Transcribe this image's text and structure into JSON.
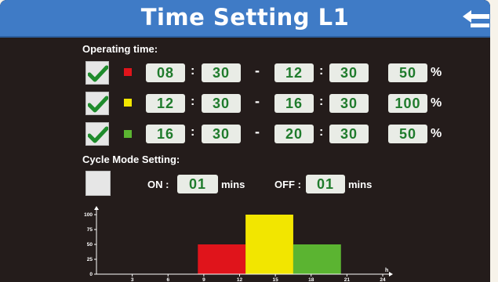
{
  "header": {
    "title": "Time Setting L1",
    "back_icon": "back-arrow-icon"
  },
  "operating": {
    "label": "Operating time:",
    "rows": [
      {
        "checked": true,
        "color": "#e0141b",
        "start_h": "08",
        "start_m": "30",
        "end_h": "12",
        "end_m": "30",
        "power": "50"
      },
      {
        "checked": true,
        "color": "#f2e600",
        "start_h": "12",
        "start_m": "30",
        "end_h": "16",
        "end_m": "30",
        "power": "100"
      },
      {
        "checked": true,
        "color": "#5bb431",
        "start_h": "16",
        "start_m": "30",
        "end_h": "20",
        "end_m": "30",
        "power": "50"
      }
    ],
    "colon": ":",
    "dash": "-",
    "percent": "%"
  },
  "cycle": {
    "label": "Cycle Mode Setting:",
    "checked": false,
    "on_label": "ON :",
    "on_value": "01",
    "off_label": "OFF :",
    "off_value": "01",
    "unit": "mins"
  },
  "chart_data": {
    "type": "bar",
    "y_ticks": [
      "100",
      "75",
      "50",
      "25",
      "0"
    ],
    "x_ticks": [
      "3",
      "6",
      "9",
      "12",
      "15",
      "18",
      "21",
      "24"
    ],
    "x_unit": "h",
    "xlim": [
      0,
      24
    ],
    "ylim": [
      0,
      100
    ],
    "bars": [
      {
        "start": 8.5,
        "end": 12.5,
        "value": 50,
        "color": "#e0141b"
      },
      {
        "start": 12.5,
        "end": 16.5,
        "value": 100,
        "color": "#f2e600"
      },
      {
        "start": 16.5,
        "end": 20.5,
        "value": 50,
        "color": "#5bb431"
      }
    ]
  }
}
